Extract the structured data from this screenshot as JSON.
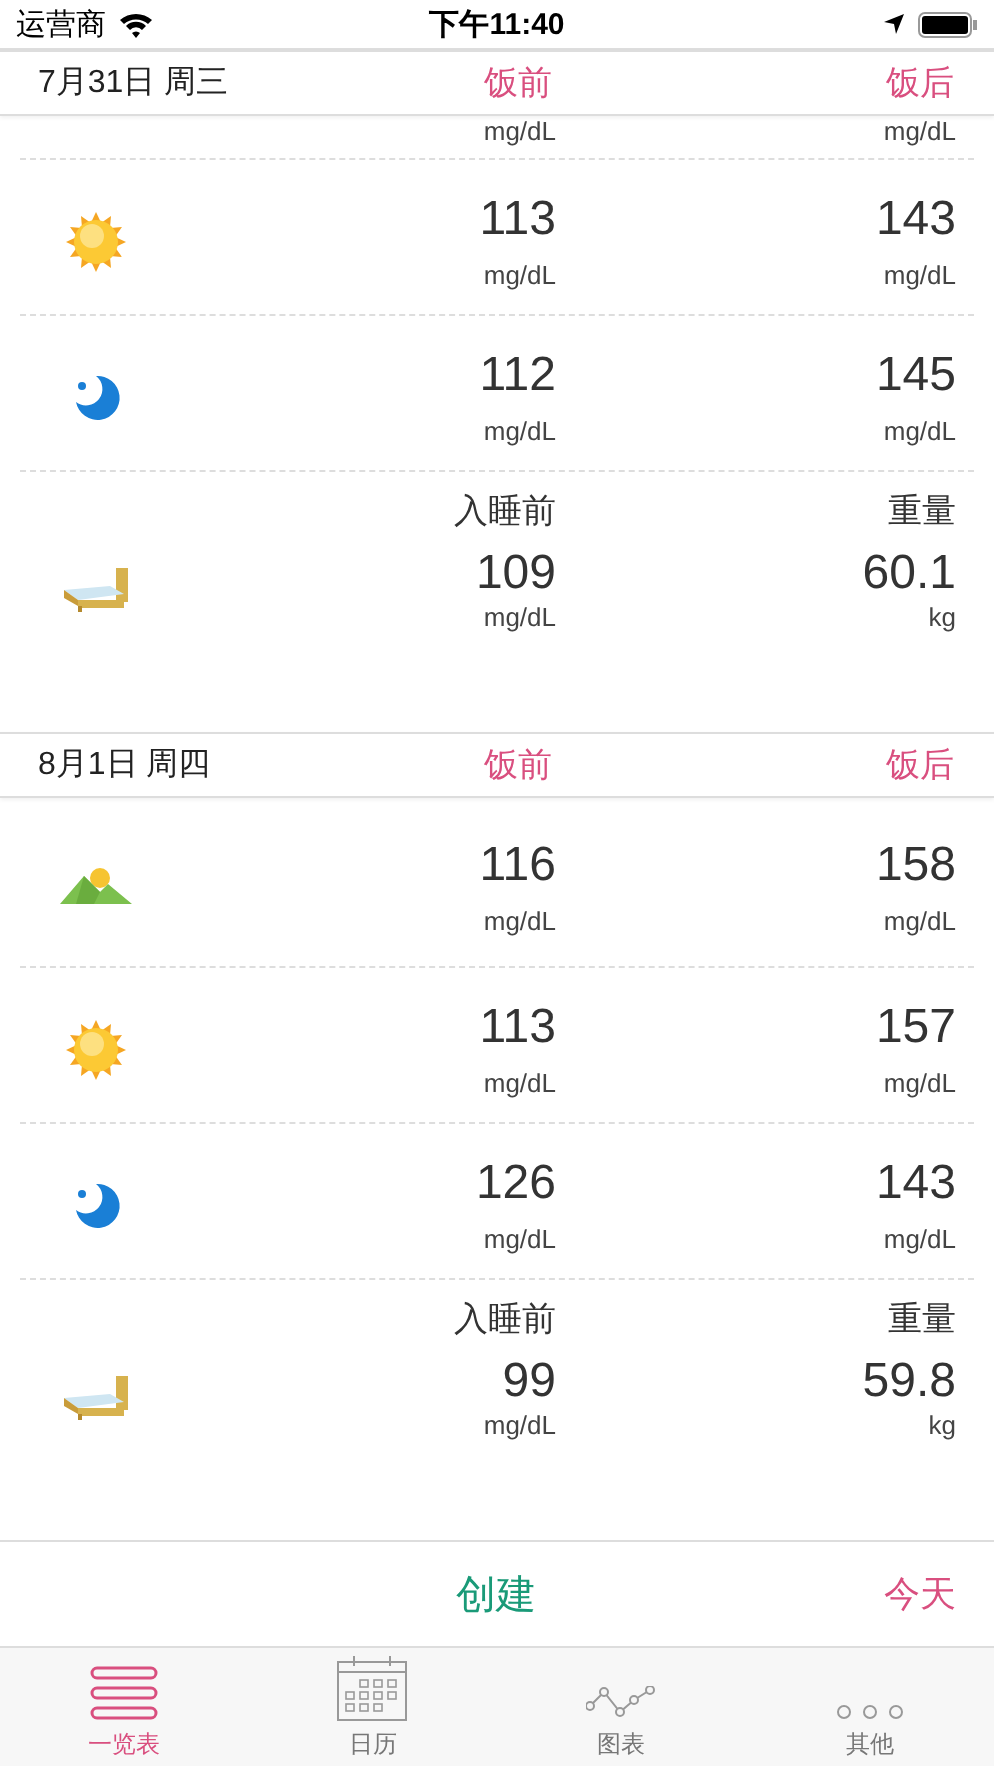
{
  "status_bar": {
    "carrier": "运营商",
    "time": "下午11:40"
  },
  "sections": [
    {
      "date": "7月31日 周三",
      "col_1": "饭前",
      "col_2": "饭后",
      "cut_row": {
        "unit_1": "mg/dL",
        "unit_2": "mg/dL"
      },
      "rows": [
        {
          "kind": "sun",
          "value_1": "113",
          "unit_1": "mg/dL",
          "value_2": "143",
          "unit_2": "mg/dL"
        },
        {
          "kind": "moon",
          "value_1": "112",
          "unit_1": "mg/dL",
          "value_2": "145",
          "unit_2": "mg/dL"
        },
        {
          "kind": "bed",
          "label_1": "入睡前",
          "label_2": "重量",
          "value_1": "109",
          "unit_1": "mg/dL",
          "value_2": "60.1",
          "unit_2": "kg"
        }
      ]
    },
    {
      "date": "8月1日 周四",
      "col_1": "饭前",
      "col_2": "饭后",
      "rows": [
        {
          "kind": "mountain",
          "value_1": "116",
          "unit_1": "mg/dL",
          "value_2": "158",
          "unit_2": "mg/dL"
        },
        {
          "kind": "sun",
          "value_1": "113",
          "unit_1": "mg/dL",
          "value_2": "157",
          "unit_2": "mg/dL"
        },
        {
          "kind": "moon",
          "value_1": "126",
          "unit_1": "mg/dL",
          "value_2": "143",
          "unit_2": "mg/dL"
        },
        {
          "kind": "bed",
          "label_1": "入睡前",
          "label_2": "重量",
          "value_1": "99",
          "unit_1": "mg/dL",
          "value_2": "59.8",
          "unit_2": "kg"
        }
      ]
    }
  ],
  "action_bar": {
    "create": "创建",
    "today": "今天"
  },
  "tabs": [
    {
      "label": "一览表",
      "selected": true
    },
    {
      "label": "日历",
      "selected": false
    },
    {
      "label": "图表",
      "selected": false
    },
    {
      "label": "其他",
      "selected": false
    }
  ]
}
